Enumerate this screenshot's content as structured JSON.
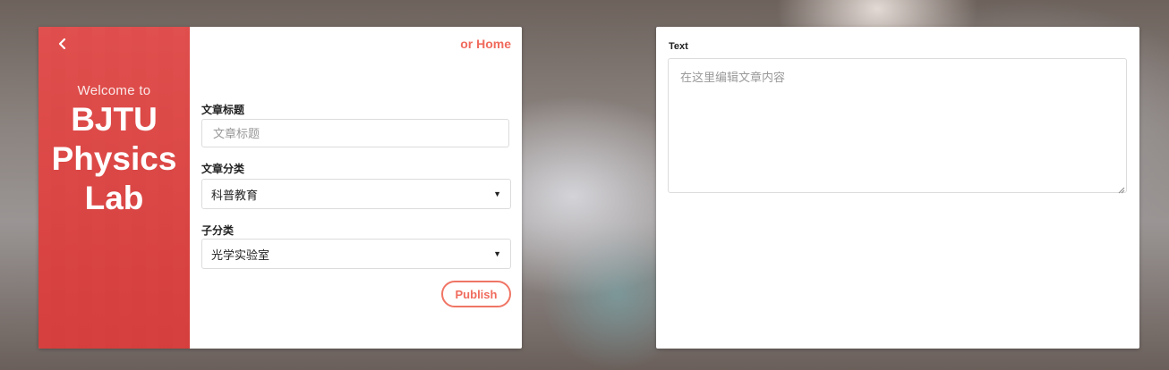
{
  "left_panel": {
    "welcome": "Welcome to",
    "brand": "BJTU\nPhysics\nLab"
  },
  "nav": {
    "home_link": "or Home"
  },
  "form": {
    "title_label": "文章标题",
    "title_placeholder": "文章标题",
    "title_value": "",
    "category_label": "文章分类",
    "category_selected": "科普教育",
    "subcategory_label": "子分类",
    "subcategory_selected": "光学实验室",
    "publish_label": "Publish"
  },
  "editor": {
    "text_label": "Text",
    "text_placeholder": "在这里编辑文章内容"
  },
  "colors": {
    "accent": "#f06b5d",
    "panel_red": "#e05250"
  }
}
